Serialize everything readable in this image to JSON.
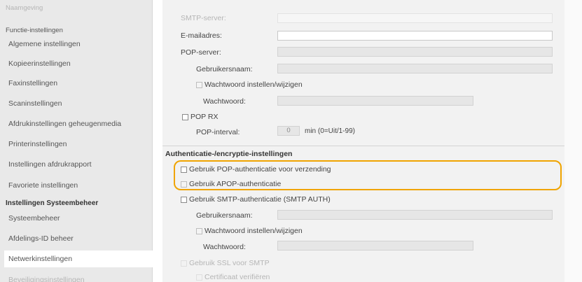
{
  "sidebar": {
    "top_faded": "Naamgeving",
    "section_functions": "Functie-instellingen",
    "items": [
      {
        "label": "Algemene instellingen"
      },
      {
        "label": "Kopieerinstellingen"
      },
      {
        "label": "Faxinstellingen"
      },
      {
        "label": "Scaninstellingen"
      },
      {
        "label": "Afdrukinstellingen geheugenmedia"
      },
      {
        "label": "Printerinstellingen"
      },
      {
        "label": "Instellingen afdrukrapport"
      },
      {
        "label": "Favoriete instellingen"
      }
    ],
    "section_admin": "Instellingen Systeembeheer",
    "admin_items": [
      {
        "label": "Systeembeheer"
      },
      {
        "label": "Afdelings-ID beheer"
      },
      {
        "label": "Netwerkinstellingen"
      },
      {
        "label": "Beveiligingsinstellingen"
      }
    ],
    "selected": "Netwerkinstellingen"
  },
  "form": {
    "smtp_server_label": "SMTP-server:",
    "email_label": "E-mailadres:",
    "pop_server_label": "POP-server:",
    "username_label": "Gebruikersnaam:",
    "set_password_label": "Wachtwoord instellen/wijzigen",
    "password_label": "Wachtwoord:",
    "pop_rx_label": "POP RX",
    "pop_interval_label": "POP-interval:",
    "pop_interval_value": "0",
    "pop_interval_unit": "min (0=Uit/1-99)",
    "auth_section_title": "Authenticatie-/encryptie-instellingen",
    "use_pop_auth_label": "Gebruik POP-authenticatie voor verzending",
    "use_apop_label": "Gebruik APOP-authenticatie",
    "use_smtp_auth_label": "Gebruik SMTP-authenticatie (SMTP AUTH)",
    "username2_label": "Gebruikersnaam:",
    "set_password2_label": "Wachtwoord instellen/wijzigen",
    "password2_label": "Wachtwoord:",
    "use_ssl_label": "Gebruik SSL voor SMTP",
    "verify_cert_label": "Certificaat verifiëren"
  },
  "colors": {
    "highlight": "#f0a400",
    "sidebar_bg": "#e9e9e9",
    "main_bg": "#f2f2f2"
  }
}
